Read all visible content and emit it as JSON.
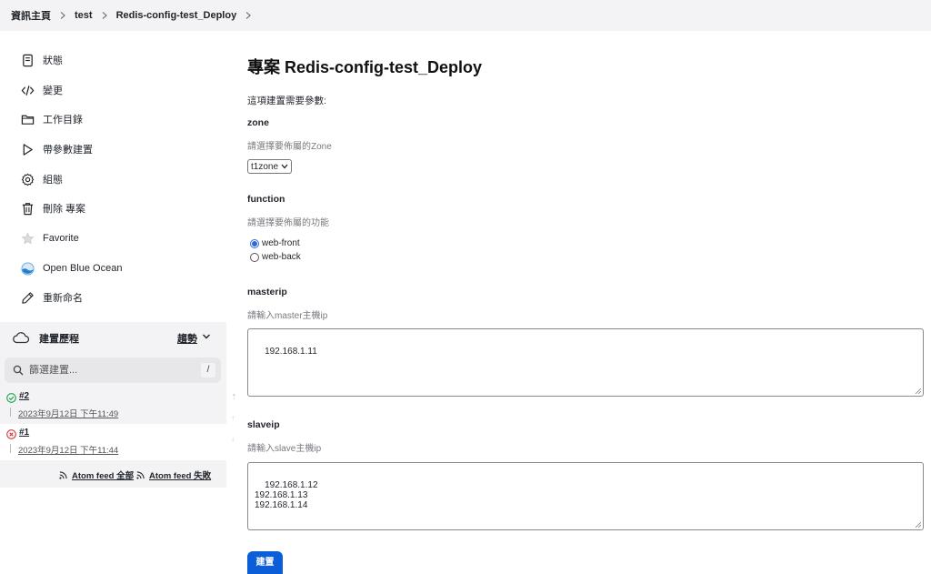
{
  "breadcrumb": {
    "items": [
      "資訊主頁",
      "test",
      "Redis-config-test_Deploy"
    ]
  },
  "sidebar": {
    "tasks": [
      {
        "label": "狀態",
        "icon": "document-icon"
      },
      {
        "label": "變更",
        "icon": "code-icon"
      },
      {
        "label": "工作目錄",
        "icon": "folder-icon"
      },
      {
        "label": "帶參數建置",
        "icon": "play-icon"
      },
      {
        "label": "組態",
        "icon": "gear-icon"
      },
      {
        "label": "刪除 專案",
        "icon": "trash-icon"
      },
      {
        "label": "Favorite",
        "icon": "star-icon"
      },
      {
        "label": "Open Blue Ocean",
        "icon": "blue-ocean-icon"
      },
      {
        "label": "重新命名",
        "icon": "pencil-icon"
      }
    ]
  },
  "build_history": {
    "title": "建置歷程",
    "trend_label": "趨勢",
    "filter_placeholder": "篩選建置...",
    "filter_shortcut": "/",
    "builds": [
      {
        "number": "#2",
        "date": "2023年9月12日 下午11:49",
        "status": "success"
      },
      {
        "number": "#1",
        "date": "2023年9月12日 下午11:44",
        "status": "failed"
      }
    ],
    "feeds": {
      "all": "Atom feed 全部",
      "failed": "Atom feed 失敗"
    }
  },
  "main": {
    "title": "專案 Redis-config-test_Deploy",
    "intro": "這項建置需要參數:",
    "params": {
      "zone": {
        "name": "zone",
        "description": "請選擇要佈屬的Zone",
        "selected": "t1zone"
      },
      "function": {
        "name": "function",
        "description": "請選擇要佈屬的功能",
        "options": [
          {
            "label": "web-front",
            "checked": true
          },
          {
            "label": "web-back",
            "checked": false
          }
        ]
      },
      "masterip": {
        "name": "masterip",
        "description": "請輸入master主機ip",
        "value": "192.168.1.11"
      },
      "slaveip": {
        "name": "slaveip",
        "description": "請輸入slave主機ip",
        "value": "192.168.1.12\n192.168.1.13\n192.168.1.14"
      }
    },
    "build_button": "建置"
  },
  "colors": {
    "accent": "#0b5ed7",
    "success": "#1ea64b",
    "failure": "#d33b3b",
    "panel": "#f3f3f5"
  }
}
